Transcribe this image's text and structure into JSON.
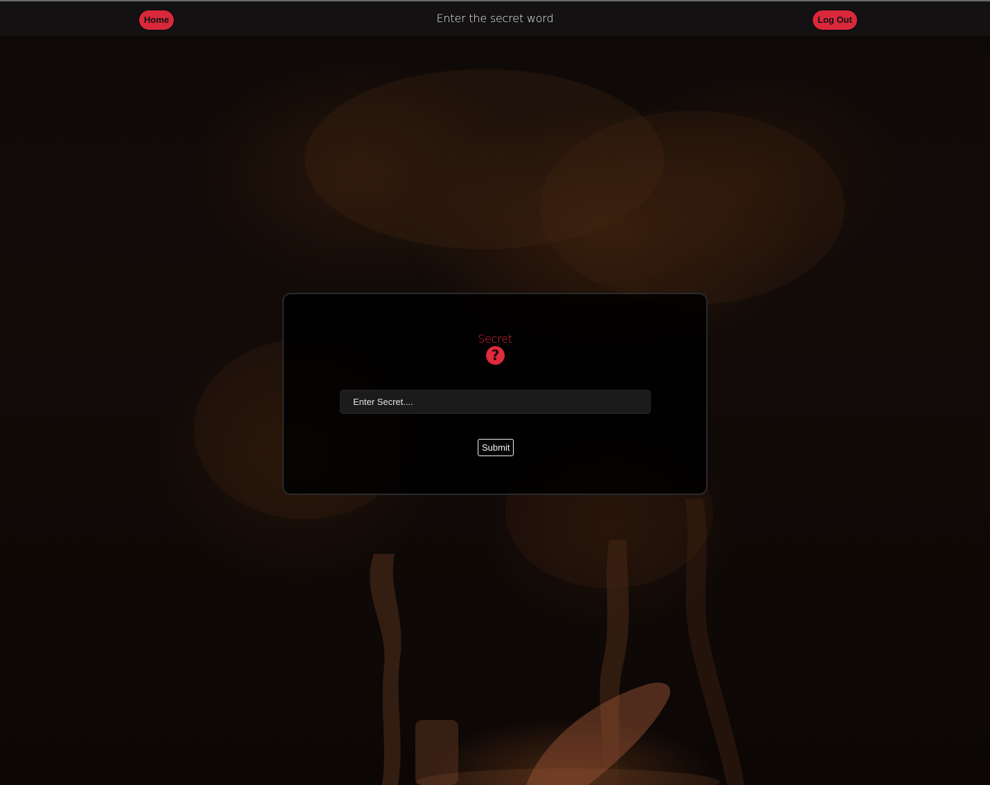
{
  "nav": {
    "home_label": "Home",
    "title": "Enter the secret word",
    "logout_label": "Log Out"
  },
  "card": {
    "heading": "Secret",
    "help_icon_glyph": "?",
    "input_placeholder": "Enter Secret....",
    "input_value": "",
    "submit_label": "Submit"
  },
  "colors": {
    "accent": "#e0283c",
    "topbar_bg": "#141212",
    "card_bg": "#000000"
  },
  "icons": {
    "help": "question-circle-icon"
  }
}
